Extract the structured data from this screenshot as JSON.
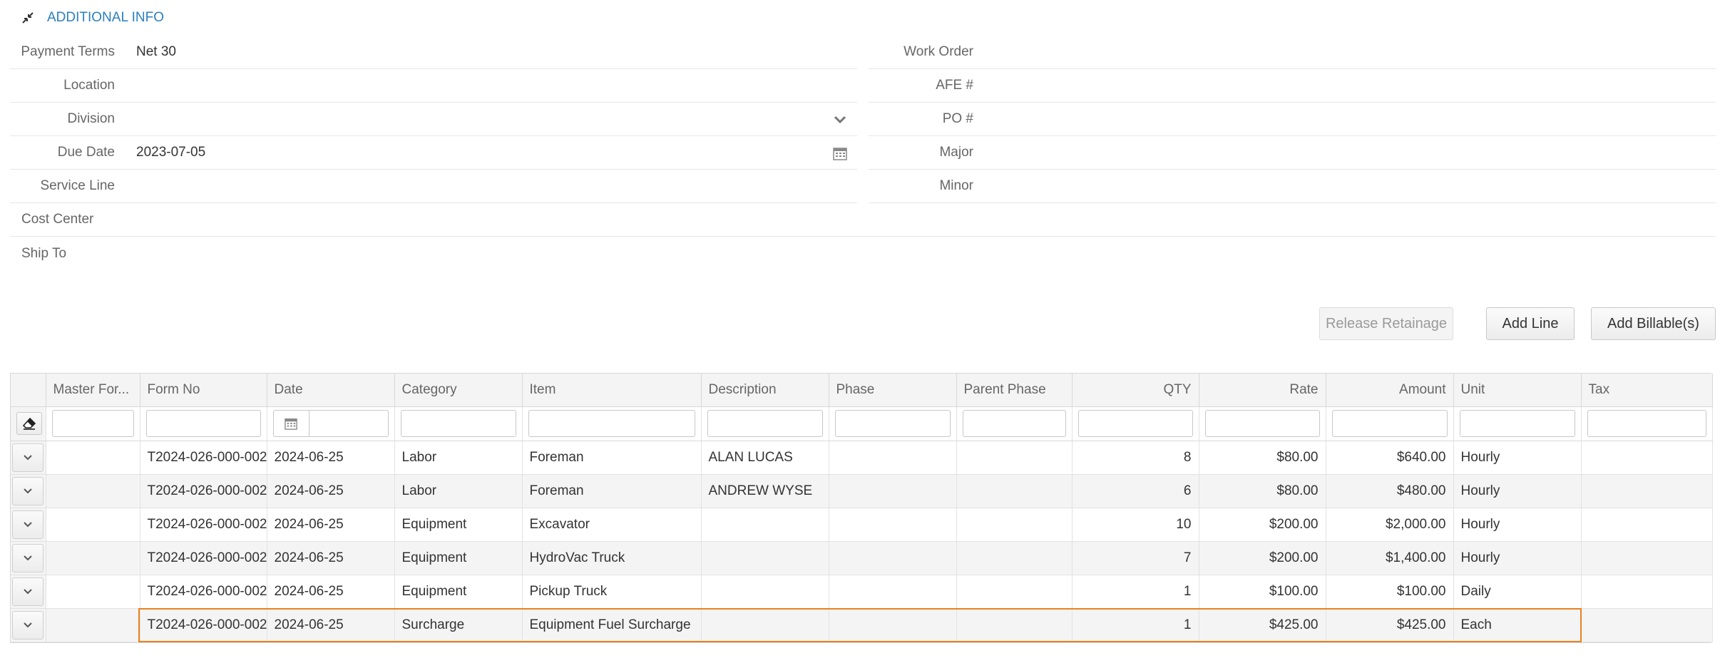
{
  "section": {
    "title": "ADDITIONAL INFO"
  },
  "form_left": [
    {
      "label": "Payment Terms",
      "value": "Net 30"
    },
    {
      "label": "Location",
      "value": ""
    },
    {
      "label": "Division",
      "value": ""
    },
    {
      "label": "Due Date",
      "value": "2023-07-05"
    },
    {
      "label": "Service Line",
      "value": ""
    },
    {
      "label": "Cost Center",
      "value": ""
    },
    {
      "label": "Ship To",
      "value": ""
    }
  ],
  "form_right": [
    {
      "label": "Work Order",
      "value": ""
    },
    {
      "label": "AFE #",
      "value": ""
    },
    {
      "label": "PO #",
      "value": ""
    },
    {
      "label": "Major",
      "value": ""
    },
    {
      "label": "Minor",
      "value": ""
    }
  ],
  "buttons": {
    "release_retainage": "Release Retainage",
    "add_line": "Add Line",
    "add_billables": "Add Billable(s)"
  },
  "grid": {
    "columns": [
      "Master For...",
      "Form No",
      "Date",
      "Category",
      "Item",
      "Description",
      "Phase",
      "Parent Phase",
      "QTY",
      "Rate",
      "Amount",
      "Unit",
      "Tax"
    ],
    "rows": [
      [
        "",
        "T2024-026-000-002",
        "2024-06-25",
        "Labor",
        "Foreman",
        "ALAN LUCAS",
        "",
        "",
        "8",
        "$80.00",
        "$640.00",
        "Hourly",
        ""
      ],
      [
        "",
        "T2024-026-000-002",
        "2024-06-25",
        "Labor",
        "Foreman",
        "ANDREW WYSE",
        "",
        "",
        "6",
        "$80.00",
        "$480.00",
        "Hourly",
        ""
      ],
      [
        "",
        "T2024-026-000-002",
        "2024-06-25",
        "Equipment",
        "Excavator",
        "",
        "",
        "",
        "10",
        "$200.00",
        "$2,000.00",
        "Hourly",
        ""
      ],
      [
        "",
        "T2024-026-000-002",
        "2024-06-25",
        "Equipment",
        "HydroVac Truck",
        "",
        "",
        "",
        "7",
        "$200.00",
        "$1,400.00",
        "Hourly",
        ""
      ],
      [
        "",
        "T2024-026-000-002",
        "2024-06-25",
        "Equipment",
        "Pickup Truck",
        "",
        "",
        "",
        "1",
        "$100.00",
        "$100.00",
        "Daily",
        ""
      ],
      [
        "",
        "T2024-026-000-002",
        "2024-06-25",
        "Surcharge",
        "Equipment Fuel Surcharge",
        "",
        "",
        "",
        "1",
        "$425.00",
        "$425.00",
        "Each",
        ""
      ]
    ]
  },
  "colors": {
    "accent": "#2a7fc1",
    "highlight": "#e8821e"
  },
  "icons": {
    "collapse": "collapse-arrows-icon",
    "dropdown": "chevron-down-icon",
    "calendar": "calendar-icon",
    "eraser": "eraser-icon",
    "expand_row": "chevron-down-icon"
  }
}
